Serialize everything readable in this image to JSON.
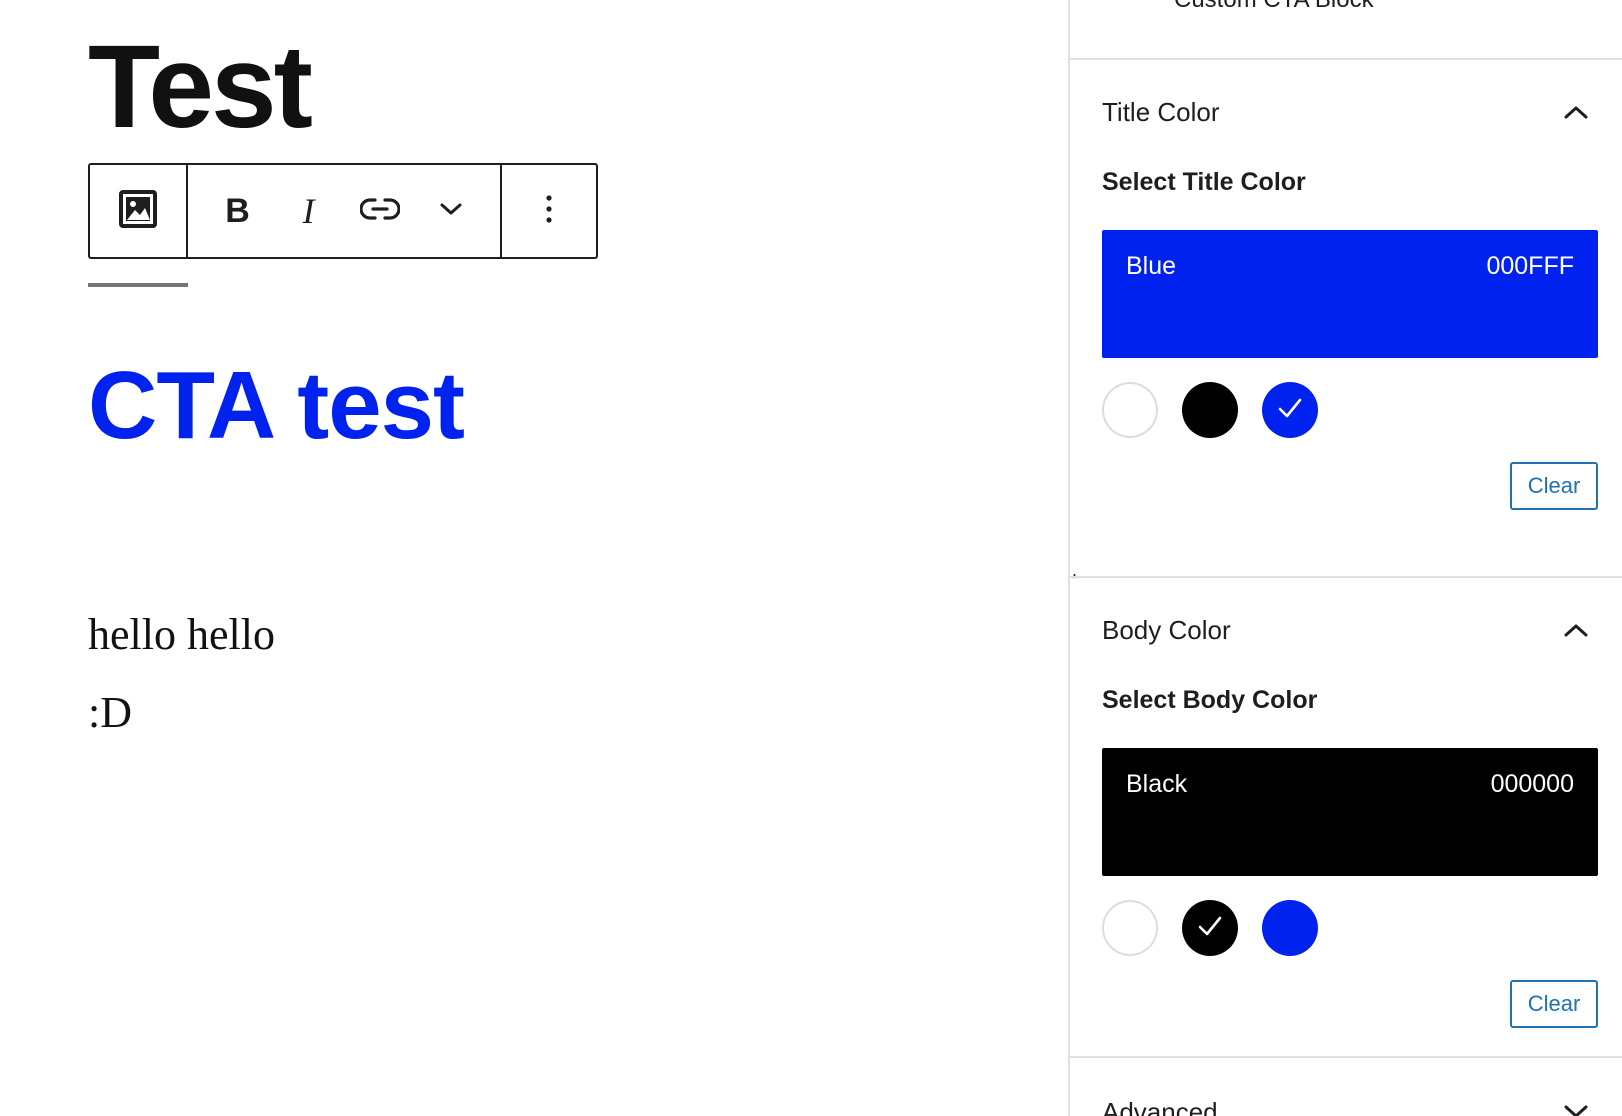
{
  "editor": {
    "post_title": "Test",
    "toolbar": {
      "block_icon": "image-icon",
      "bold_label": "B",
      "italic_label": "I",
      "link_icon": "link-icon",
      "more_icon": "chevron-down-icon",
      "options_icon": "more-vertical-icon"
    },
    "cta_title": "CTA test",
    "cta_title_color": "#0022ee",
    "cta_body": [
      "hello hello",
      ":D"
    ]
  },
  "sidebar": {
    "block_card_name": "Custom CTA Block",
    "stray_char": ",",
    "panels": [
      {
        "title": "Title Color",
        "expanded": true,
        "field_label": "Select Title Color",
        "selected": {
          "name": "Blue",
          "hex": "000FFF",
          "color": "#0022ee"
        },
        "swatches": [
          {
            "name": "White",
            "color": "#ffffff",
            "selected": false
          },
          {
            "name": "Black",
            "color": "#000000",
            "selected": false
          },
          {
            "name": "Blue",
            "color": "#0022ee",
            "selected": true
          }
        ],
        "clear_label": "Clear"
      },
      {
        "title": "Body Color",
        "expanded": true,
        "field_label": "Select Body Color",
        "selected": {
          "name": "Black",
          "hex": "000000",
          "color": "#000000"
        },
        "swatches": [
          {
            "name": "White",
            "color": "#ffffff",
            "selected": false
          },
          {
            "name": "Black",
            "color": "#000000",
            "selected": true
          },
          {
            "name": "Blue",
            "color": "#0022ee",
            "selected": false
          }
        ],
        "clear_label": "Clear"
      },
      {
        "title": "Advanced",
        "expanded": false
      }
    ]
  },
  "colors": {
    "accent": "#2271b1",
    "border": "#e0e0e0"
  }
}
